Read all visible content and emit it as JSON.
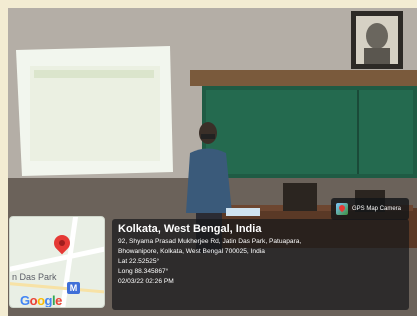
{
  "badge": {
    "label": "GPS Map Camera",
    "icon": "gps-map-camera-icon"
  },
  "map": {
    "place_label": "n Das Park",
    "metro_icon": "M",
    "pin_icon": "map-pin-icon",
    "logo_text": "Google"
  },
  "location": {
    "title": "Kolkata, West Bengal, India",
    "address_line1": "92, Shyama Prasad Mukherjee Rd, Jatin Das Park, Patuapara,",
    "address_line2": "Bhowanipore, Kolkata, West Bengal 700025, India",
    "lat": "Lat 22.52525°",
    "long": "Long 88.345867°",
    "timestamp": "02/03/22 02:26 PM"
  }
}
